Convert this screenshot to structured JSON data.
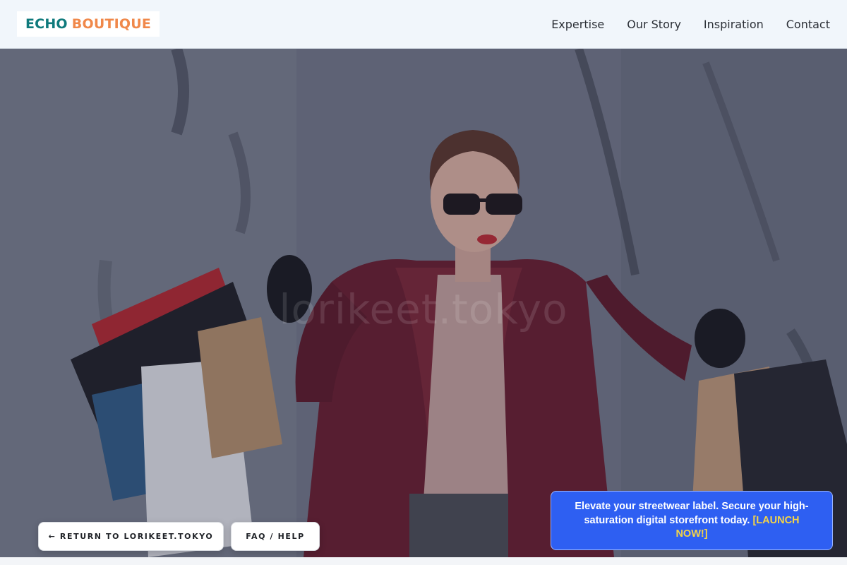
{
  "header": {
    "logo": {
      "part1": "ECHO",
      "part2": "BOUTIQUE"
    },
    "nav": [
      {
        "label": "Expertise"
      },
      {
        "label": "Our Story"
      },
      {
        "label": "Inspiration"
      },
      {
        "label": "Contact"
      }
    ]
  },
  "hero": {
    "image": "woman-with-shopping-bags-photo",
    "watermark": "lorikeet.tokyo"
  },
  "buttons": {
    "return_label": "← RETURN TO LORIKEET.TOKYO",
    "faq_label": "FAQ / HELP"
  },
  "promo": {
    "text": "Elevate your streetwear label. Secure your high-saturation digital storefront today.",
    "cta": "[LAUNCH NOW!]"
  },
  "colors": {
    "logo_primary": "#0f7a7c",
    "logo_accent": "#f0884a",
    "promo_bg": "#2e5ff2",
    "promo_cta": "#f5d547"
  }
}
